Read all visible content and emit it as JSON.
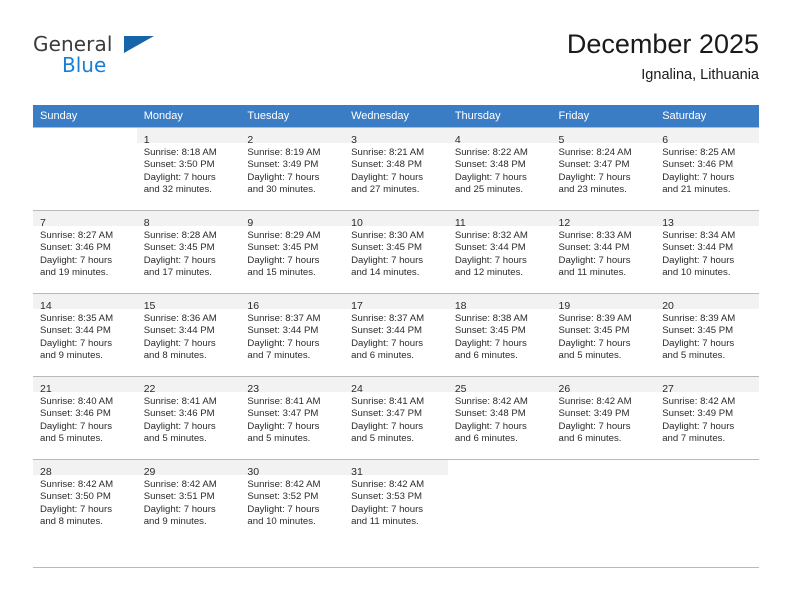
{
  "logo": {
    "word_top": "General",
    "word_bottom": "Blue",
    "triangle_color": "#1565a8",
    "blue_color": "#1a7fd4"
  },
  "header": {
    "title": "December 2025",
    "subtitle": "Ignalina, Lithuania"
  },
  "colors": {
    "header_bar": "#3b7dc4",
    "day_number_bar": "#f2f2f2",
    "grid_line": "#b9b9b9",
    "text": "#2b2b2b"
  },
  "weekdays": [
    "Sunday",
    "Monday",
    "Tuesday",
    "Wednesday",
    "Thursday",
    "Friday",
    "Saturday"
  ],
  "weeks": [
    [
      {
        "day": "",
        "lines": [
          "",
          "",
          "",
          ""
        ],
        "empty": true
      },
      {
        "day": "1",
        "lines": [
          "Sunrise: 8:18 AM",
          "Sunset: 3:50 PM",
          "Daylight: 7 hours",
          "and 32 minutes."
        ]
      },
      {
        "day": "2",
        "lines": [
          "Sunrise: 8:19 AM",
          "Sunset: 3:49 PM",
          "Daylight: 7 hours",
          "and 30 minutes."
        ]
      },
      {
        "day": "3",
        "lines": [
          "Sunrise: 8:21 AM",
          "Sunset: 3:48 PM",
          "Daylight: 7 hours",
          "and 27 minutes."
        ]
      },
      {
        "day": "4",
        "lines": [
          "Sunrise: 8:22 AM",
          "Sunset: 3:48 PM",
          "Daylight: 7 hours",
          "and 25 minutes."
        ]
      },
      {
        "day": "5",
        "lines": [
          "Sunrise: 8:24 AM",
          "Sunset: 3:47 PM",
          "Daylight: 7 hours",
          "and 23 minutes."
        ]
      },
      {
        "day": "6",
        "lines": [
          "Sunrise: 8:25 AM",
          "Sunset: 3:46 PM",
          "Daylight: 7 hours",
          "and 21 minutes."
        ]
      }
    ],
    [
      {
        "day": "7",
        "lines": [
          "Sunrise: 8:27 AM",
          "Sunset: 3:46 PM",
          "Daylight: 7 hours",
          "and 19 minutes."
        ]
      },
      {
        "day": "8",
        "lines": [
          "Sunrise: 8:28 AM",
          "Sunset: 3:45 PM",
          "Daylight: 7 hours",
          "and 17 minutes."
        ]
      },
      {
        "day": "9",
        "lines": [
          "Sunrise: 8:29 AM",
          "Sunset: 3:45 PM",
          "Daylight: 7 hours",
          "and 15 minutes."
        ]
      },
      {
        "day": "10",
        "lines": [
          "Sunrise: 8:30 AM",
          "Sunset: 3:45 PM",
          "Daylight: 7 hours",
          "and 14 minutes."
        ]
      },
      {
        "day": "11",
        "lines": [
          "Sunrise: 8:32 AM",
          "Sunset: 3:44 PM",
          "Daylight: 7 hours",
          "and 12 minutes."
        ]
      },
      {
        "day": "12",
        "lines": [
          "Sunrise: 8:33 AM",
          "Sunset: 3:44 PM",
          "Daylight: 7 hours",
          "and 11 minutes."
        ]
      },
      {
        "day": "13",
        "lines": [
          "Sunrise: 8:34 AM",
          "Sunset: 3:44 PM",
          "Daylight: 7 hours",
          "and 10 minutes."
        ]
      }
    ],
    [
      {
        "day": "14",
        "lines": [
          "Sunrise: 8:35 AM",
          "Sunset: 3:44 PM",
          "Daylight: 7 hours",
          "and 9 minutes."
        ]
      },
      {
        "day": "15",
        "lines": [
          "Sunrise: 8:36 AM",
          "Sunset: 3:44 PM",
          "Daylight: 7 hours",
          "and 8 minutes."
        ]
      },
      {
        "day": "16",
        "lines": [
          "Sunrise: 8:37 AM",
          "Sunset: 3:44 PM",
          "Daylight: 7 hours",
          "and 7 minutes."
        ]
      },
      {
        "day": "17",
        "lines": [
          "Sunrise: 8:37 AM",
          "Sunset: 3:44 PM",
          "Daylight: 7 hours",
          "and 6 minutes."
        ]
      },
      {
        "day": "18",
        "lines": [
          "Sunrise: 8:38 AM",
          "Sunset: 3:45 PM",
          "Daylight: 7 hours",
          "and 6 minutes."
        ]
      },
      {
        "day": "19",
        "lines": [
          "Sunrise: 8:39 AM",
          "Sunset: 3:45 PM",
          "Daylight: 7 hours",
          "and 5 minutes."
        ]
      },
      {
        "day": "20",
        "lines": [
          "Sunrise: 8:39 AM",
          "Sunset: 3:45 PM",
          "Daylight: 7 hours",
          "and 5 minutes."
        ]
      }
    ],
    [
      {
        "day": "21",
        "lines": [
          "Sunrise: 8:40 AM",
          "Sunset: 3:46 PM",
          "Daylight: 7 hours",
          "and 5 minutes."
        ]
      },
      {
        "day": "22",
        "lines": [
          "Sunrise: 8:41 AM",
          "Sunset: 3:46 PM",
          "Daylight: 7 hours",
          "and 5 minutes."
        ]
      },
      {
        "day": "23",
        "lines": [
          "Sunrise: 8:41 AM",
          "Sunset: 3:47 PM",
          "Daylight: 7 hours",
          "and 5 minutes."
        ]
      },
      {
        "day": "24",
        "lines": [
          "Sunrise: 8:41 AM",
          "Sunset: 3:47 PM",
          "Daylight: 7 hours",
          "and 5 minutes."
        ]
      },
      {
        "day": "25",
        "lines": [
          "Sunrise: 8:42 AM",
          "Sunset: 3:48 PM",
          "Daylight: 7 hours",
          "and 6 minutes."
        ]
      },
      {
        "day": "26",
        "lines": [
          "Sunrise: 8:42 AM",
          "Sunset: 3:49 PM",
          "Daylight: 7 hours",
          "and 6 minutes."
        ]
      },
      {
        "day": "27",
        "lines": [
          "Sunrise: 8:42 AM",
          "Sunset: 3:49 PM",
          "Daylight: 7 hours",
          "and 7 minutes."
        ]
      }
    ],
    [
      {
        "day": "28",
        "lines": [
          "Sunrise: 8:42 AM",
          "Sunset: 3:50 PM",
          "Daylight: 7 hours",
          "and 8 minutes."
        ]
      },
      {
        "day": "29",
        "lines": [
          "Sunrise: 8:42 AM",
          "Sunset: 3:51 PM",
          "Daylight: 7 hours",
          "and 9 minutes."
        ]
      },
      {
        "day": "30",
        "lines": [
          "Sunrise: 8:42 AM",
          "Sunset: 3:52 PM",
          "Daylight: 7 hours",
          "and 10 minutes."
        ]
      },
      {
        "day": "31",
        "lines": [
          "Sunrise: 8:42 AM",
          "Sunset: 3:53 PM",
          "Daylight: 7 hours",
          "and 11 minutes."
        ]
      },
      {
        "day": "",
        "lines": [
          "",
          "",
          "",
          ""
        ],
        "empty": true
      },
      {
        "day": "",
        "lines": [
          "",
          "",
          "",
          ""
        ],
        "empty": true
      },
      {
        "day": "",
        "lines": [
          "",
          "",
          "",
          ""
        ],
        "empty": true
      }
    ]
  ]
}
